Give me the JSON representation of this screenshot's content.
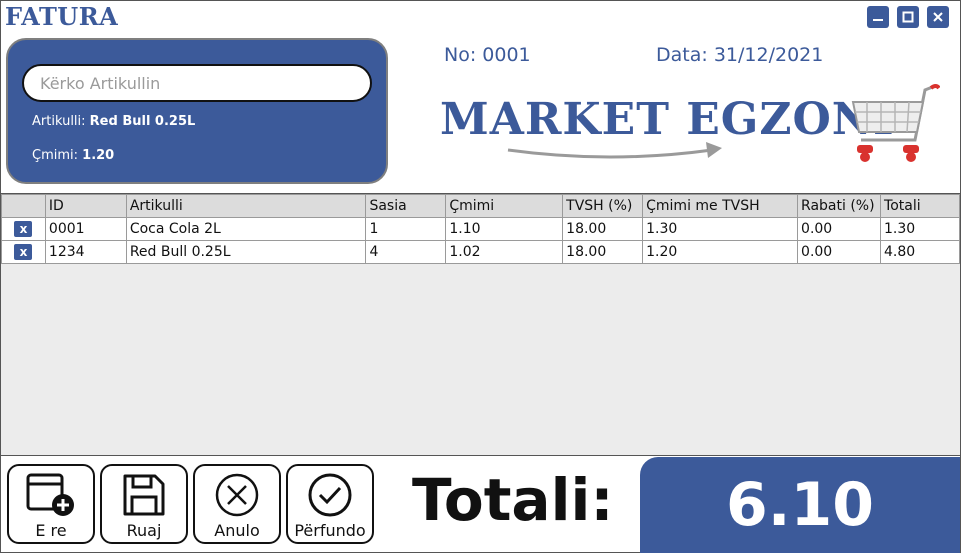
{
  "window": {
    "title": "FATURA",
    "controls": [
      "minimize-icon",
      "maximize-icon",
      "close-icon"
    ]
  },
  "search": {
    "placeholder": "Kërko Artikullin",
    "value": "",
    "item_label": "Artikulli:",
    "item_value": "Red Bull 0.25L",
    "price_label": "Çmimi:",
    "price_value": "1.20"
  },
  "invoice": {
    "no_label": "No:",
    "no_value": "0001",
    "date_label": "Data:",
    "date_value": "31/12/2021"
  },
  "brand": {
    "name": "MARKET EGZONI",
    "icon": "shopping-cart-icon"
  },
  "table": {
    "headers": [
      "",
      "ID",
      "Artikulli",
      "Sasia",
      "Çmimi",
      "TVSH (%)",
      "Çmimi me TVSH",
      "Rabati (%)",
      "Totali"
    ],
    "delete_label": "x",
    "rows": [
      [
        "0001",
        "Coca Cola 2L",
        "1",
        "1.10",
        "18.00",
        "1.30",
        "0.00",
        "1.30"
      ],
      [
        "1234",
        "Red Bull 0.25L",
        "4",
        "1.02",
        "18.00",
        "1.20",
        "0.00",
        "4.80"
      ]
    ]
  },
  "actions": [
    {
      "label": "E re",
      "icon": "new-document-icon"
    },
    {
      "label": "Ruaj",
      "icon": "save-icon"
    },
    {
      "label": "Anulo",
      "icon": "cancel-icon"
    },
    {
      "label": "Përfundo",
      "icon": "check-icon"
    }
  ],
  "total": {
    "label": "Totali:",
    "value": "6.10"
  },
  "colors": {
    "accent": "#3c5a9a",
    "header_bg": "#dcdcdc",
    "grid_bg": "#ececec",
    "cart_red": "#d9322e"
  }
}
